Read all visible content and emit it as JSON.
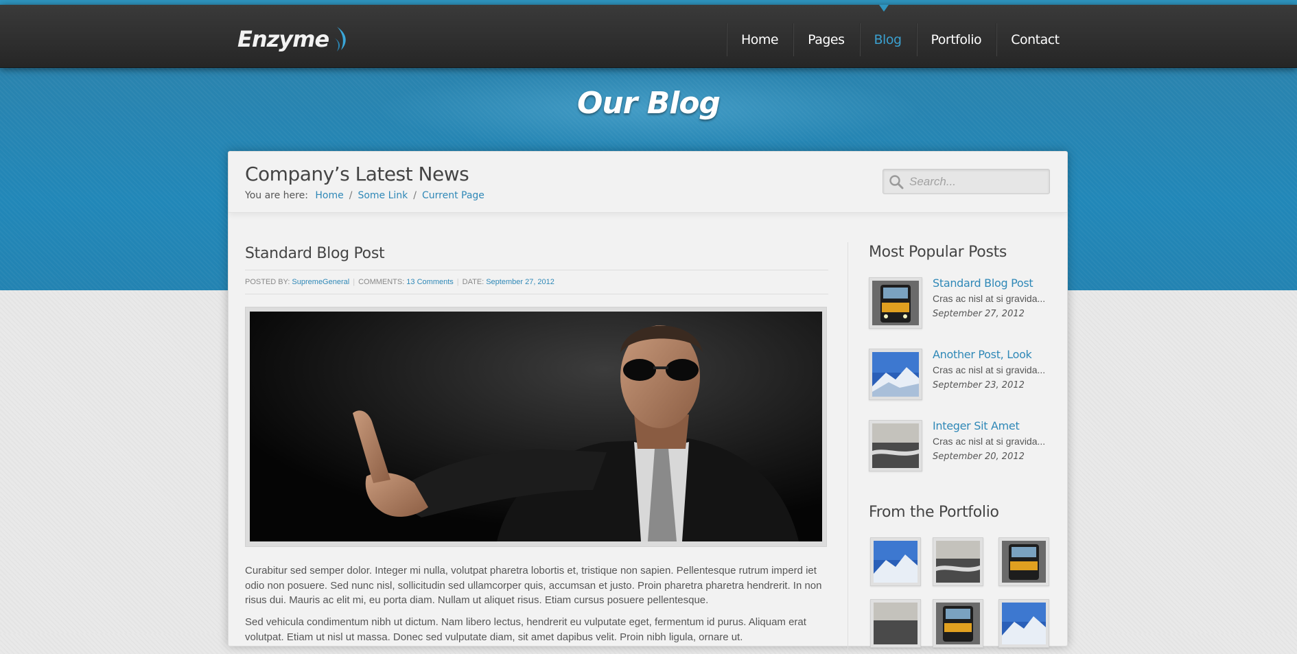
{
  "header": {
    "logo": "Enzyme",
    "nav": [
      "Home",
      "Pages",
      "Blog",
      "Portfolio",
      "Contact"
    ],
    "active_nav": "Blog"
  },
  "banner": {
    "title": "Our Blog"
  },
  "page": {
    "title": "Company’s Latest News",
    "breadcrumb_prefix": "You are here:",
    "breadcrumb": [
      "Home",
      "Some Link",
      "Current Page"
    ],
    "search_placeholder": "Search..."
  },
  "post": {
    "title": "Standard Blog Post",
    "meta": {
      "posted_by_label": "POSTED BY:",
      "posted_by": "SupremeGeneral",
      "comments_label": "COMMENTS:",
      "comments": "13 Comments",
      "date_label": "DATE:",
      "date": "September 27, 2012"
    },
    "paragraphs": [
      "Curabitur sed semper dolor. Integer mi nulla, volutpat pharetra lobortis et, tristique non sapien. Pellentesque rutrum imperd iet odio non posuere. Sed nunc nisl, sollicitudin sed ullamcorper quis, accumsan et justo. Proin pharetra pharetra hendrerit. In non risus dui. Mauris ac elit mi, eu porta diam. Nullam ut aliquet risus. Etiam cursus posuere pellentesque.",
      "Sed vehicula condimentum nibh ut dictum. Nam libero lectus, hendrerit eu vulputate eget, fermentum id purus. Aliquam erat volutpat. Etiam ut nisl ut massa. Donec sed vulputate diam, sit amet dapibus velit. Proin nibh ligula, ornare ut."
    ]
  },
  "sidebar": {
    "popular_title": "Most Popular Posts",
    "popular": [
      {
        "title": "Standard Blog Post",
        "excerpt": "Cras ac nisl at si gravida...",
        "date": "September 27, 2012",
        "thumb": "train"
      },
      {
        "title": "Another Post, Look",
        "excerpt": "Cras ac nisl at si gravida...",
        "date": "September 23, 2012",
        "thumb": "mountain"
      },
      {
        "title": "Integer Sit Amet",
        "excerpt": "Cras ac nisl at si gravida...",
        "date": "September 20, 2012",
        "thumb": "sea"
      }
    ],
    "portfolio_title": "From the Portfolio",
    "portfolio": [
      "mountain",
      "sea",
      "train",
      "sea",
      "train",
      "mountain"
    ]
  },
  "colors": {
    "accent": "#2f95c0",
    "link": "#2f88b7",
    "header_bg": "#2b2b2b",
    "banner_bg": "#2386b6"
  }
}
